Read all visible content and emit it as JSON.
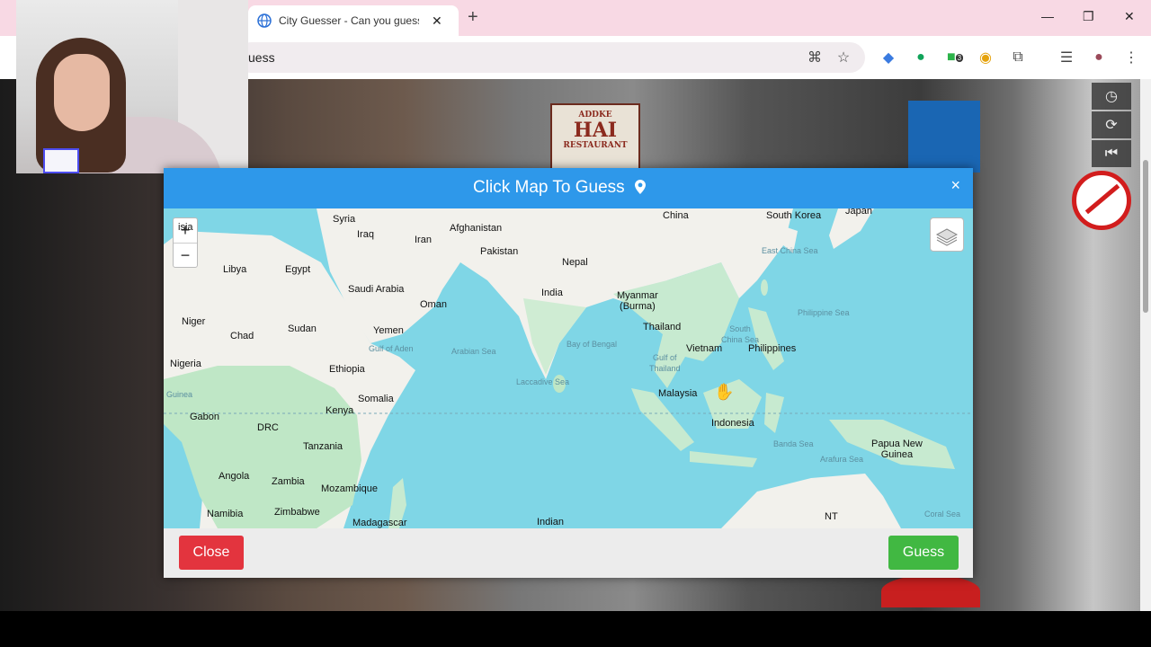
{
  "browser": {
    "tab_title": "City Guesser - Can you guess w",
    "url_fragment": "uess",
    "ext_badge": "3"
  },
  "streetview": {
    "sign_line1": "ADDKE",
    "sign_line2": "HAI",
    "sign_line3": "RESTAURANT"
  },
  "modal": {
    "title": "Click Map To Guess",
    "close_x": "×",
    "close_label": "Close",
    "guess_label": "Guess"
  },
  "map": {
    "zoom_in": "+",
    "zoom_out": "−",
    "labels": [
      {
        "name": "lbl-asia",
        "text": "isia",
        "sea": false
      },
      {
        "name": "lbl-syria",
        "text": "Syria",
        "sea": false
      },
      {
        "name": "lbl-iraq",
        "text": "Iraq",
        "sea": false
      },
      {
        "name": "lbl-iran",
        "text": "Iran",
        "sea": false
      },
      {
        "name": "lbl-afghanistan",
        "text": "Afghanistan",
        "sea": false
      },
      {
        "name": "lbl-pakistan",
        "text": "Pakistan",
        "sea": false
      },
      {
        "name": "lbl-china",
        "text": "China",
        "sea": false
      },
      {
        "name": "lbl-south-korea",
        "text": "South Korea",
        "sea": false
      },
      {
        "name": "lbl-japan",
        "text": "Japan",
        "sea": false
      },
      {
        "name": "lbl-libya",
        "text": "Libya",
        "sea": false
      },
      {
        "name": "lbl-egypt",
        "text": "Egypt",
        "sea": false
      },
      {
        "name": "lbl-nepal",
        "text": "Nepal",
        "sea": false
      },
      {
        "name": "lbl-saudi-arabia",
        "text": "Saudi Arabia",
        "sea": false
      },
      {
        "name": "lbl-india",
        "text": "India",
        "sea": false
      },
      {
        "name": "lbl-myanmar",
        "text": "Myanmar\n(Burma)",
        "sea": false
      },
      {
        "name": "lbl-oman",
        "text": "Oman",
        "sea": false
      },
      {
        "name": "lbl-niger",
        "text": "Niger",
        "sea": false
      },
      {
        "name": "lbl-sudan",
        "text": "Sudan",
        "sea": false
      },
      {
        "name": "lbl-chad",
        "text": "Chad",
        "sea": false
      },
      {
        "name": "lbl-yemen",
        "text": "Yemen",
        "sea": false
      },
      {
        "name": "lbl-thailand",
        "text": "Thailand",
        "sea": false
      },
      {
        "name": "lbl-vietnam",
        "text": "Vietnam",
        "sea": false
      },
      {
        "name": "lbl-philippines",
        "text": "Philippines",
        "sea": false
      },
      {
        "name": "lbl-nigeria",
        "text": "Nigeria",
        "sea": false
      },
      {
        "name": "lbl-ethiopia",
        "text": "Ethiopia",
        "sea": false
      },
      {
        "name": "lbl-somalia",
        "text": "Somalia",
        "sea": false
      },
      {
        "name": "lbl-malaysia",
        "text": "Malaysia",
        "sea": false
      },
      {
        "name": "lbl-gabon",
        "text": "Gabon",
        "sea": false
      },
      {
        "name": "lbl-kenya",
        "text": "Kenya",
        "sea": false
      },
      {
        "name": "lbl-drc",
        "text": "DRC",
        "sea": false
      },
      {
        "name": "lbl-indonesia",
        "text": "Indonesia",
        "sea": false
      },
      {
        "name": "lbl-tanzania",
        "text": "Tanzania",
        "sea": false
      },
      {
        "name": "lbl-papua",
        "text": "Papua New\nGuinea",
        "sea": false
      },
      {
        "name": "lbl-angola",
        "text": "Angola",
        "sea": false
      },
      {
        "name": "lbl-zambia",
        "text": "Zambia",
        "sea": false
      },
      {
        "name": "lbl-mozambique",
        "text": "Mozambique",
        "sea": false
      },
      {
        "name": "lbl-namibia",
        "text": "Namibia",
        "sea": false
      },
      {
        "name": "lbl-zimbabwe",
        "text": "Zimbabwe",
        "sea": false
      },
      {
        "name": "lbl-madagascar",
        "text": "Madagascar",
        "sea": false
      },
      {
        "name": "lbl-indian",
        "text": "Indian",
        "sea": false
      },
      {
        "name": "lbl-nt",
        "text": "NT",
        "sea": false
      },
      {
        "name": "lbl-east-china-sea",
        "text": "East China Sea",
        "sea": true
      },
      {
        "name": "lbl-philippine-sea",
        "text": "Philippine Sea",
        "sea": true
      },
      {
        "name": "lbl-south-china-sea",
        "text": "South\nChina Sea",
        "sea": true
      },
      {
        "name": "lbl-bay-of-bengal",
        "text": "Bay of Bengal",
        "sea": true
      },
      {
        "name": "lbl-arabian-sea",
        "text": "Arabian Sea",
        "sea": true
      },
      {
        "name": "lbl-laccadive-sea",
        "text": "Laccadive Sea",
        "sea": true
      },
      {
        "name": "lbl-gulf-of-aden",
        "text": "Gulf of Aden",
        "sea": true
      },
      {
        "name": "lbl-gulf-of-thailand",
        "text": "Gulf of\nThailand",
        "sea": true
      },
      {
        "name": "lbl-banda-sea",
        "text": "Banda Sea",
        "sea": true
      },
      {
        "name": "lbl-arafura-sea",
        "text": "Arafura Sea",
        "sea": true
      },
      {
        "name": "lbl-coral-sea",
        "text": "Coral Sea",
        "sea": true
      },
      {
        "name": "lbl-guinea",
        "text": "Guinea",
        "sea": true
      }
    ]
  },
  "colors": {
    "modal_header": "#2e98ea",
    "close_button": "#e3343e",
    "guess_button": "#41b842",
    "water": "#7fd6e6",
    "land": "#f2f1ec",
    "vegetation": "#bfe7c6"
  }
}
